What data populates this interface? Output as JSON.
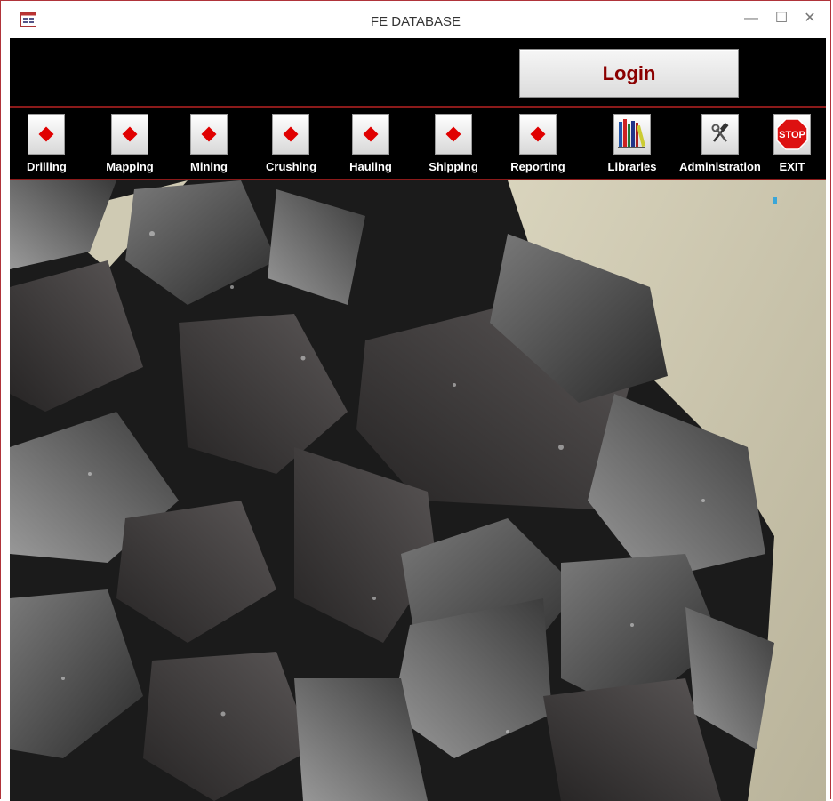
{
  "window": {
    "title": "FE DATABASE",
    "minimize": "—",
    "maximize": "☐",
    "close": "✕"
  },
  "header": {
    "login_label": "Login"
  },
  "toolbar": {
    "items": [
      {
        "label": "Drilling",
        "icon": "diamond-icon"
      },
      {
        "label": "Mapping",
        "icon": "diamond-icon"
      },
      {
        "label": "Mining",
        "icon": "diamond-icon"
      },
      {
        "label": "Crushing",
        "icon": "diamond-icon"
      },
      {
        "label": "Hauling",
        "icon": "diamond-icon"
      },
      {
        "label": "Shipping",
        "icon": "diamond-icon"
      },
      {
        "label": "Reporting",
        "icon": "diamond-icon"
      },
      {
        "label": "Libraries",
        "icon": "books-icon"
      },
      {
        "label": "Administration",
        "icon": "tools-icon"
      },
      {
        "label": "EXIT",
        "icon": "stop-sign-icon",
        "sign_text": "STOP"
      }
    ]
  },
  "colors": {
    "accent_red": "#e00000",
    "login_text": "#8b0000",
    "band_line": "#8b1a1a",
    "background": "#000000"
  }
}
